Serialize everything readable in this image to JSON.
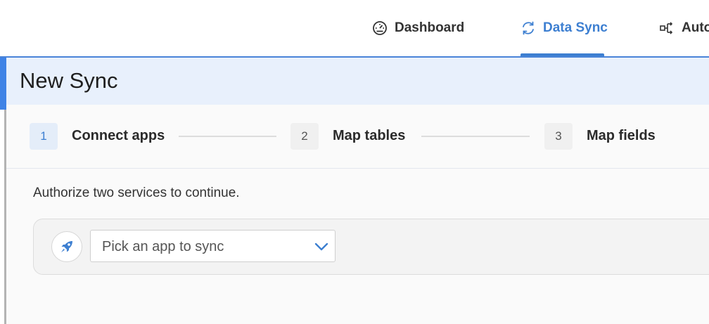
{
  "nav": {
    "tabs": [
      {
        "label": "Dashboard",
        "icon": "gauge-icon",
        "active": false
      },
      {
        "label": "Data Sync",
        "icon": "sync-icon",
        "active": true
      },
      {
        "label": "Auto",
        "icon": "automation-icon",
        "active": false
      }
    ]
  },
  "page": {
    "title": "New Sync"
  },
  "stepper": {
    "steps": [
      {
        "number": "1",
        "label": "Connect apps",
        "active": true
      },
      {
        "number": "2",
        "label": "Map tables",
        "active": false
      },
      {
        "number": "3",
        "label": "Map fields",
        "active": false
      }
    ]
  },
  "instructions": "Authorize two services to continue.",
  "app_picker": {
    "icon": "rocket-icon",
    "placeholder": "Pick an app to sync",
    "chevron_icon": "chevron-down-icon"
  },
  "colors": {
    "accent": "#3d7fd1",
    "header_band": "#e8f0fc",
    "left_accent": "#3f83e6"
  }
}
